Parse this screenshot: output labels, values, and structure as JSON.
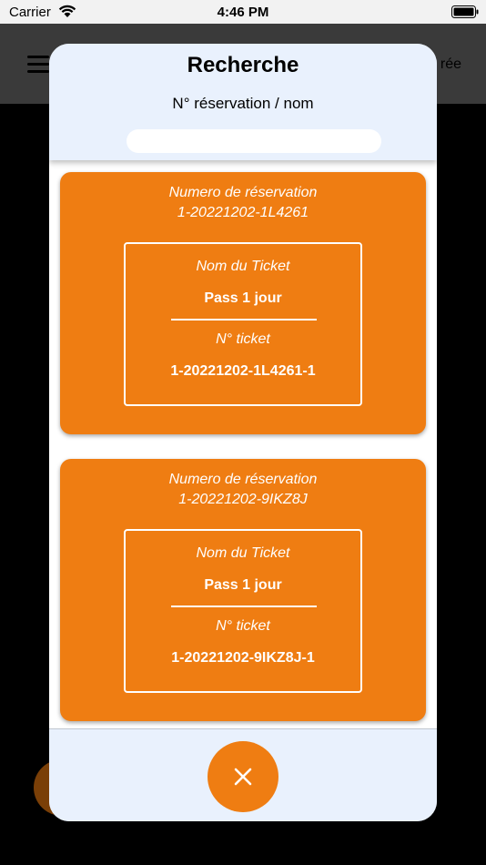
{
  "status_bar": {
    "carrier": "Carrier",
    "time": "4:46 PM"
  },
  "app_header": {
    "trailing_text": "rée"
  },
  "modal": {
    "title": "Recherche",
    "search": {
      "label": "N° réservation / nom",
      "value": "",
      "placeholder": ""
    },
    "results": [
      {
        "reservation_label": "Numero de réservation",
        "reservation_number": "1-20221202-1L4261",
        "ticket_name_label": "Nom du Ticket",
        "ticket_name": "Pass 1 jour",
        "ticket_number_label": "N° ticket",
        "ticket_number": "1-20221202-1L4261-1"
      },
      {
        "reservation_label": "Numero de réservation",
        "reservation_number": "1-20221202-9IKZ8J",
        "ticket_name_label": "Nom du Ticket",
        "ticket_name": "Pass 1 jour",
        "ticket_number_label": "N° ticket",
        "ticket_number": "1-20221202-9IKZ8J-1"
      }
    ],
    "close_icon": "close-icon"
  },
  "colors": {
    "accent_orange": "#ef7d12",
    "modal_panel": "#e9f1fd",
    "header_bg": "#3a3a3a"
  }
}
